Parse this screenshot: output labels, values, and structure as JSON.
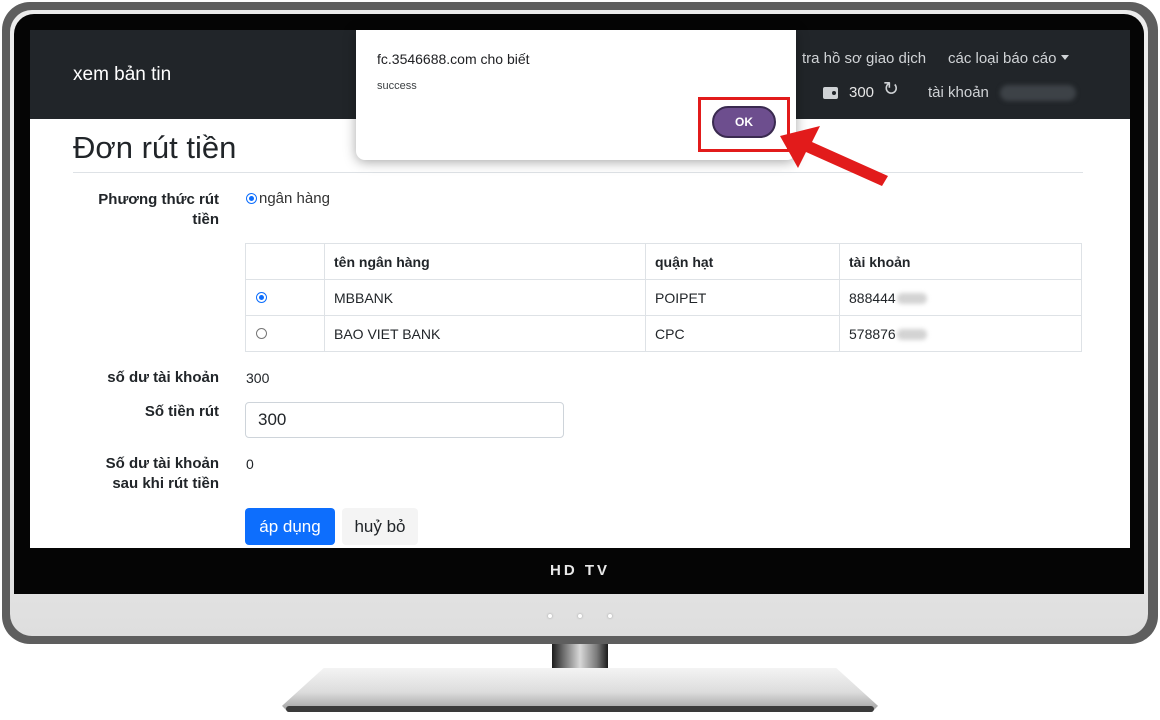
{
  "navbar": {
    "brand": "xem bản tin",
    "history_link": "tra hồ sơ giao dịch",
    "reports_link": "các loại báo cáo",
    "balance": "300",
    "account_label": "tài khoản"
  },
  "page": {
    "title": "Đơn rút tiền"
  },
  "form": {
    "method_label": "Phương thức rút tiền",
    "method_option": "ngân hàng",
    "table": {
      "headers": [
        "tên ngân hàng",
        "quận hạt",
        "tài khoản"
      ],
      "rows": [
        {
          "bank": "MBBANK",
          "branch": "POIPET",
          "account": "888444",
          "selected": true
        },
        {
          "bank": "BAO VIET BANK",
          "branch": "CPC",
          "account": "578876",
          "selected": false
        }
      ]
    },
    "balance_label": "số dư tài khoản",
    "balance_value": "300",
    "amount_label": "Số tiền rút",
    "amount_value": "300",
    "after_label": "Số dư tài khoản sau khi rút tiền",
    "after_value": "0",
    "apply_button": "áp dụng",
    "cancel_button": "huỷ bỏ"
  },
  "dialog": {
    "origin": "fc.3546688.com cho biết",
    "message": "success",
    "ok_button": "OK"
  },
  "tv": {
    "brand": "HD TV"
  },
  "colors": {
    "navbar_bg": "#212529",
    "primary": "#0d6efd",
    "ok_button": "#6d4e8e",
    "highlight": "#e21b1b"
  }
}
